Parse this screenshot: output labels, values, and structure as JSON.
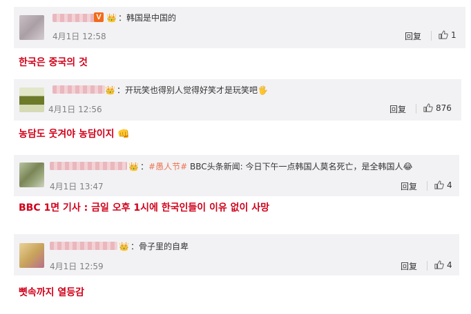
{
  "comments": [
    {
      "text": "：韩国是中国的",
      "time": "4月1日 12:58",
      "reply_label": "回复",
      "likes": "1",
      "translation": "한국은 중국의 것"
    },
    {
      "text": "：开玩笑也得别人觉得好笑才是玩笑吧",
      "emoji": "🖐",
      "time": "4月1日 12:56",
      "reply_label": "回复",
      "likes": "876",
      "translation": "농담도 웃겨야 농담이지 👊"
    },
    {
      "text_prefix": "：",
      "topic": "#愚人节#",
      "text": " BBC头条新闻: 今日下午一点韩国人莫名死亡，是全韩国人",
      "emoji": "😂",
      "time": "4月1日 13:47",
      "reply_label": "回复",
      "likes": "4",
      "translation": "BBC 1면 기사 : 금일 오후 1시에 한국인들이 이유 없이 사망"
    },
    {
      "text": "：骨子里的自卑",
      "time": "4月1日 12:59",
      "reply_label": "回复",
      "likes": "4",
      "translation": "뼛속까지 열등감"
    }
  ],
  "badges": {
    "verified": "V"
  },
  "icons": {
    "like": "thumbs-up-icon",
    "member": "crown-icon"
  },
  "colors": {
    "translation": "#d0021b",
    "topic": "#eb7350",
    "card_bg": "#f2f2f5"
  }
}
